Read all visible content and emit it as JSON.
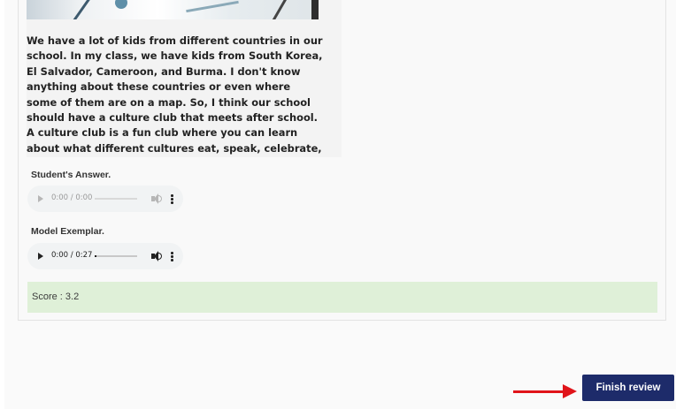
{
  "passage": {
    "text": "We have a lot of kids from different countries in our school. In my class, we have kids from South Korea, El Salvador, Cameroon, and Burma. I don't know anything about these countries or even where some of them are on a map. So, I think our school should have a culture club that meets after school. A culture club is a fun club where you can learn about what different cultures eat, speak, celebrate, and so much more. Since we have so"
  },
  "student_answer": {
    "label": "Student's Answer.",
    "time": "0:00 / 0:00",
    "progress": 0,
    "state": "disabled"
  },
  "model_exemplar": {
    "label": "Model Exemplar.",
    "time": "0:00 / 0:27",
    "progress": 0.04,
    "state": "enabled"
  },
  "score": {
    "text": "Score : 3.2",
    "bg_color": "#dff0d8"
  },
  "finish_button": {
    "label": "Finish review",
    "color": "#1d2b6a"
  },
  "annotation_arrow": {
    "color": "#e0141a"
  },
  "icons": {
    "play": "play-icon",
    "volume": "volume-icon",
    "more": "more-options-icon",
    "scroll_down": "chevron-down-icon"
  }
}
